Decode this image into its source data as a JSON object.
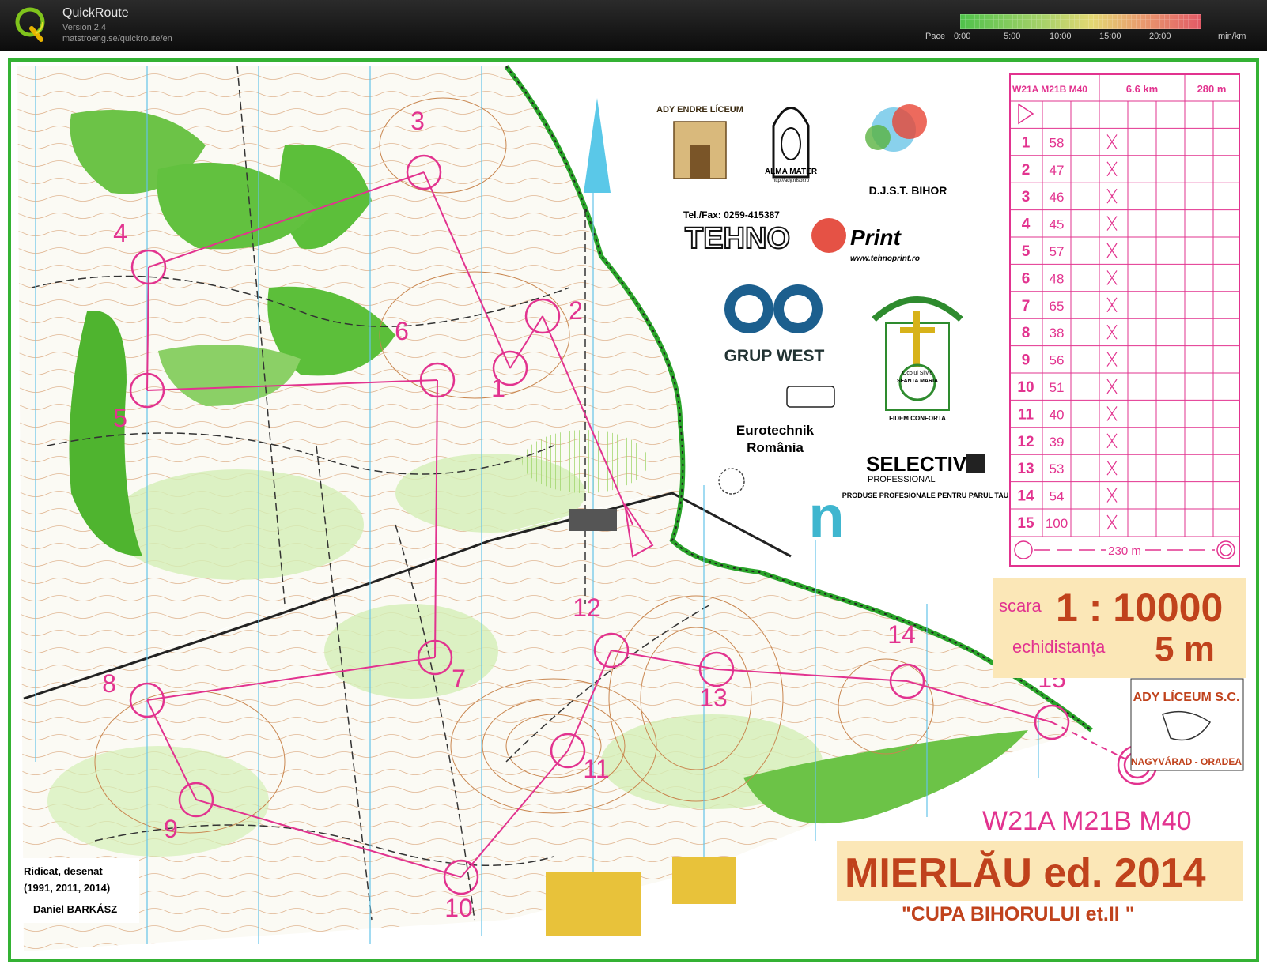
{
  "app": {
    "title": "QuickRoute",
    "version": "Version 2.4",
    "url": "matstroeng.se/quickroute/en"
  },
  "pace": {
    "label": "Pace",
    "ticks": [
      "0:00",
      "5:00",
      "10:00",
      "15:00",
      "20:00"
    ],
    "unit": "min/km"
  },
  "map": {
    "sponsors": {
      "ady_endre": "ADY ENDRE LÍCEUM",
      "alma_mater": "ALMA MATER",
      "alma_url": "http://ady.rdsor.ro",
      "djst": "D.J.S.T. BIHOR",
      "tehno_phone": "Tel./Fax: 0259-415387",
      "tehno_name": "TEHNO",
      "tehno_print": "Print",
      "tehno_url": "www.tehnoprint.ro",
      "grup_west": "GRUP WEST",
      "ocolul": "Ocolul Silvic",
      "spanta": "SFANTA MARIA",
      "fidem": "FIDEM CONFORTA",
      "eurotechnik": "Eurotechnik",
      "romania": "România",
      "selective": "SELECTIVE",
      "professional": "PROFESSIONAL",
      "produse": "PRODUSE PROFESIONALE PENTRU PARUL TAU",
      "n_logo": "n",
      "ady_school_1": "ADY LÍCEUM S.C.",
      "ady_school_2": "NAGYVÁRAD - ORADEA"
    },
    "description": {
      "header_category": "W21A M21B M40",
      "header_length": "6.6 km",
      "header_climb": "280 m",
      "controls": [
        {
          "num": "1",
          "code": "58"
        },
        {
          "num": "2",
          "code": "47"
        },
        {
          "num": "3",
          "code": "46"
        },
        {
          "num": "4",
          "code": "45"
        },
        {
          "num": "5",
          "code": "57"
        },
        {
          "num": "6",
          "code": "48"
        },
        {
          "num": "7",
          "code": "65"
        },
        {
          "num": "8",
          "code": "38"
        },
        {
          "num": "9",
          "code": "56"
        },
        {
          "num": "10",
          "code": "51"
        },
        {
          "num": "11",
          "code": "40"
        },
        {
          "num": "12",
          "code": "39"
        },
        {
          "num": "13",
          "code": "53"
        },
        {
          "num": "14",
          "code": "54"
        },
        {
          "num": "15",
          "code": "100"
        }
      ],
      "finish_distance": "230 m"
    },
    "scale": {
      "scara": "scara",
      "scale_value": "1 : 10000",
      "echidistanta": "echidistanţa",
      "contour": "5 m"
    },
    "category": "W21A M21B M40",
    "event": "MIERLĂU ed. 2014",
    "cup": "\"CUPA BIHORULUI et.II \"",
    "credits": {
      "line1": "Ridicat, desenat",
      "line2": "(1991, 2011, 2014)",
      "line3": "Daniel BARKÁSZ"
    },
    "course_labels": [
      "1",
      "2",
      "3",
      "4",
      "5",
      "6",
      "7",
      "8",
      "9",
      "10",
      "11",
      "12",
      "13",
      "14",
      "15"
    ]
  },
  "colors": {
    "course": "#e2338f",
    "border_green": "#2fae2f",
    "forest": "#5cbf3a",
    "light_green": "#c9eaa8",
    "contour": "#c9864f"
  }
}
